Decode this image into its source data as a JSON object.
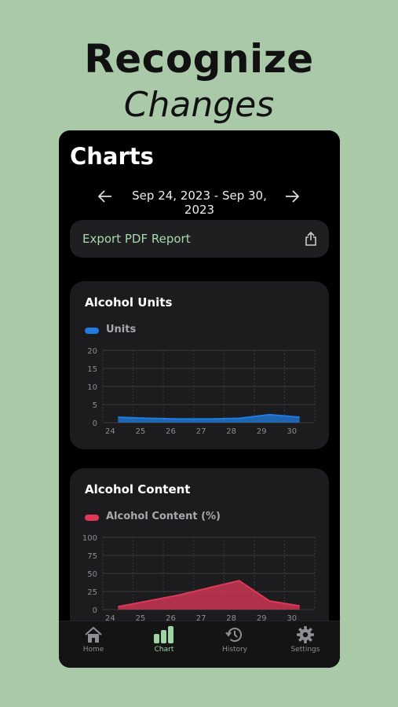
{
  "promo": {
    "line1": "Recognize",
    "line2": "Changes"
  },
  "screen": {
    "title": "Charts",
    "date_range": "Sep 24, 2023 - Sep 30, 2023",
    "prev_icon": "arrow-left-icon",
    "next_icon": "arrow-right-icon",
    "export_label": "Export PDF Report",
    "share_icon": "share-icon"
  },
  "colors": {
    "units": "#1f7ce0",
    "content": "#e0385a",
    "accent": "#9fd4a7"
  },
  "chart_data": [
    {
      "type": "area",
      "title": "Alcohol Units",
      "categories": [
        "24",
        "25",
        "26",
        "27",
        "28",
        "29",
        "30"
      ],
      "series": [
        {
          "name": "Units",
          "values": [
            1.5,
            1.2,
            1.0,
            1.0,
            1.2,
            2.2,
            1.5
          ]
        }
      ],
      "yticks": [
        "20",
        "15",
        "10",
        "5",
        "0"
      ],
      "ylim": [
        0,
        20
      ],
      "legend": "top-left",
      "grid": true
    },
    {
      "type": "area",
      "title": "Alcohol Content",
      "categories": [
        "24",
        "25",
        "26",
        "27",
        "28",
        "29",
        "30"
      ],
      "series": [
        {
          "name": "Alcohol Content (%)",
          "values": [
            4,
            12,
            20,
            30,
            40,
            12,
            5
          ]
        }
      ],
      "yticks": [
        "100",
        "75",
        "50",
        "25",
        "0"
      ],
      "ylim": [
        0,
        100
      ],
      "legend": "top-left",
      "grid": true
    }
  ],
  "tabbar": [
    {
      "label": "Home",
      "icon": "home-icon"
    },
    {
      "label": "Chart",
      "icon": "chart-icon",
      "active": true
    },
    {
      "label": "History",
      "icon": "history-icon"
    },
    {
      "label": "Settings",
      "icon": "gear-icon"
    }
  ]
}
